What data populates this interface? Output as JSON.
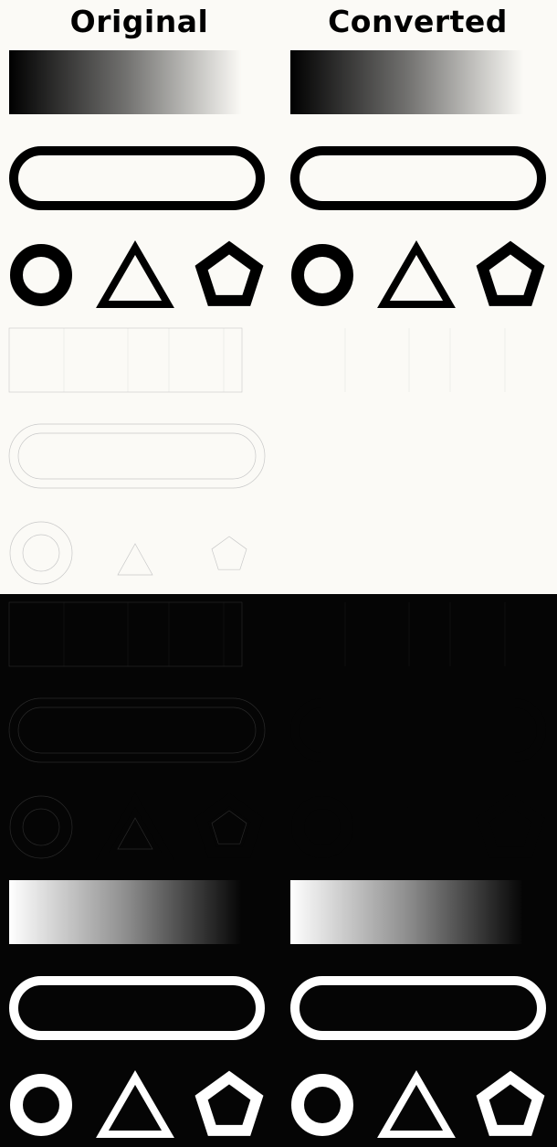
{
  "headers": {
    "original": "Original",
    "converted": "Converted"
  },
  "colors": {
    "light_background": "#fbfaf6",
    "dark_background": "#050505",
    "black": "#000000",
    "white": "#ffffff",
    "light_ghost": "#fbfaf6",
    "dark_ghost": "#050505",
    "ghost_outline_light": "#c8c8c8",
    "ghost_outline_dark": "#2a2a2a"
  },
  "sections": [
    {
      "background": "light",
      "variant": "black-on-light",
      "gradient": "black-to-transparent"
    },
    {
      "background": "light",
      "variant": "ghost-white-on-light",
      "gradient": "white-to-transparent"
    },
    {
      "background": "dark",
      "variant": "ghost-black-on-dark",
      "gradient": "black-to-transparent"
    },
    {
      "background": "dark",
      "variant": "white-on-dark",
      "gradient": "white-to-transparent"
    }
  ],
  "columns": [
    "original",
    "converted"
  ],
  "shapes_per_row": [
    "circle-ring",
    "triangle-outline",
    "pentagon-outline"
  ]
}
